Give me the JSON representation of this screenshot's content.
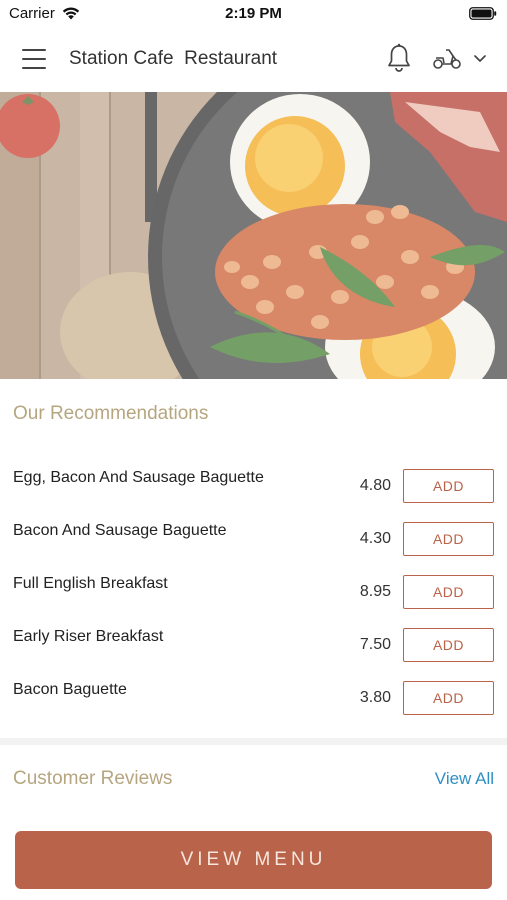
{
  "status_bar": {
    "carrier": "Carrier",
    "time": "2:19 PM"
  },
  "header": {
    "title": "Station Cafe  Restaurant",
    "icons": [
      "menu-icon",
      "bell-icon",
      "scooter-icon",
      "chevron-down-icon"
    ]
  },
  "recommendations": {
    "title": "Our Recommendations",
    "items": [
      {
        "name": "Egg, Bacon And Sausage Baguette",
        "price": "4.80",
        "button": "ADD"
      },
      {
        "name": "Bacon And Sausage Baguette",
        "price": "4.30",
        "button": "ADD"
      },
      {
        "name": "Full English Breakfast",
        "price": "8.95",
        "button": "ADD"
      },
      {
        "name": "Early Riser Breakfast",
        "price": "7.50",
        "button": "ADD"
      },
      {
        "name": "Bacon Baguette",
        "price": "3.80",
        "button": "ADD"
      }
    ]
  },
  "reviews": {
    "title": "Customer Reviews",
    "view_all": "View All"
  },
  "footer": {
    "view_menu": "VIEW MENU"
  },
  "colors": {
    "accent": "#b9634a",
    "section_title": "#b6a680",
    "link": "#2e8fc4"
  }
}
